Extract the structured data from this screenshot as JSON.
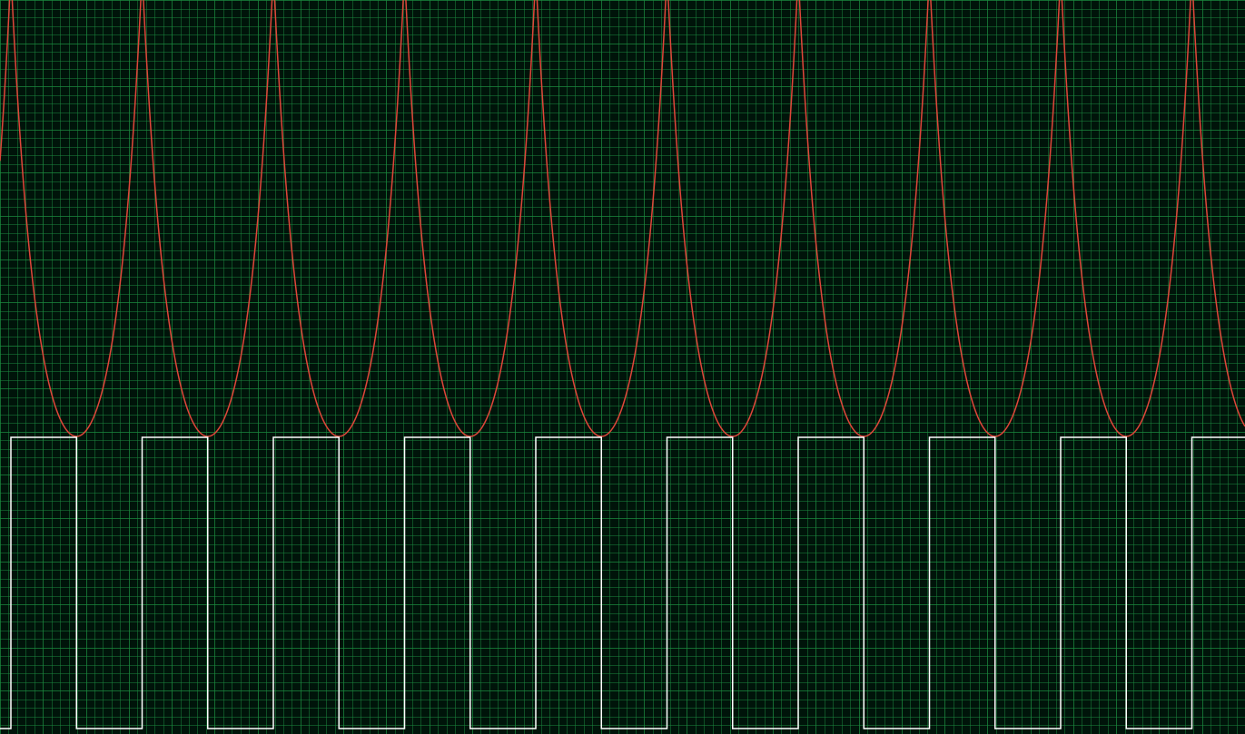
{
  "colors": {
    "background": "#00140a",
    "grid": "#1b8a3f",
    "trace_red": "#e0463a",
    "trace_white": "#ffffff"
  },
  "chart_data": {
    "type": "line",
    "title": "",
    "xlabel": "",
    "ylabel": "",
    "grid": true,
    "grid_divisions_x": 145,
    "grid_divisions_y": 85,
    "x_range": [
      0,
      19
    ],
    "series": [
      {
        "trace": "red",
        "shape": "periodic-cusp",
        "period": 2,
        "phase": 0,
        "y_range": [
          0,
          1
        ],
        "baseline": 0,
        "peak_clipped": true
      },
      {
        "trace": "white",
        "shape": "square",
        "period": 2,
        "phase": 0,
        "duty_cycle": 0.5,
        "levels": [
          0,
          1
        ]
      }
    ]
  }
}
